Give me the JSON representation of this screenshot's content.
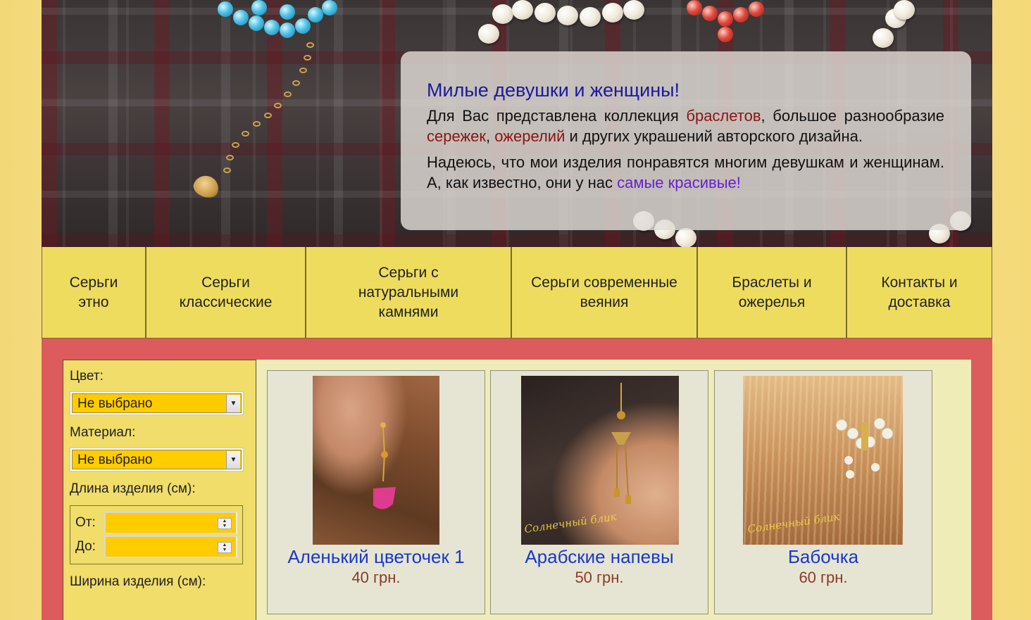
{
  "intro": {
    "title": "Милые девушки и женщины!",
    "p1": {
      "t1": "Для Вас представлена коллекция ",
      "link_bracelets": "браслетов",
      "t2": ", большое разнообразие ",
      "link_earrings": "сережек",
      "t3": ", ",
      "link_necklaces": "ожерелий",
      "t4": " и других украшений авторского дизайна."
    },
    "p2": {
      "t1": "Надеюсь, что мои изделия понравятся многим девушкам и женщинам. А, как известно, они у нас ",
      "highlight": "самые красивые!"
    }
  },
  "menu": {
    "items": [
      {
        "label": "Серьги этно"
      },
      {
        "label": "Серьги классические"
      },
      {
        "label": "Серьги с натуральными камнями"
      },
      {
        "label": "Серьги современные веяния"
      },
      {
        "label": "Браслеты и ожерелья"
      },
      {
        "label": "Контакты и доставка"
      }
    ]
  },
  "filters": {
    "color_label": "Цвет:",
    "color_value": "Не выбрано",
    "material_label": "Материал:",
    "material_value": "Не выбрано",
    "length_label": "Длина изделия (см):",
    "from_label": "От:",
    "to_label": "До:",
    "width_label": "Ширина изделия (см):"
  },
  "products": [
    {
      "name": "Аленький цветочек 1",
      "price": "40 грн."
    },
    {
      "name": "Арабские напевы",
      "price": "50 грн.",
      "watermark": "Солнечный блик"
    },
    {
      "name": "Бабочка",
      "price": "60 грн.",
      "watermark": "Солнечный блик"
    }
  ]
}
